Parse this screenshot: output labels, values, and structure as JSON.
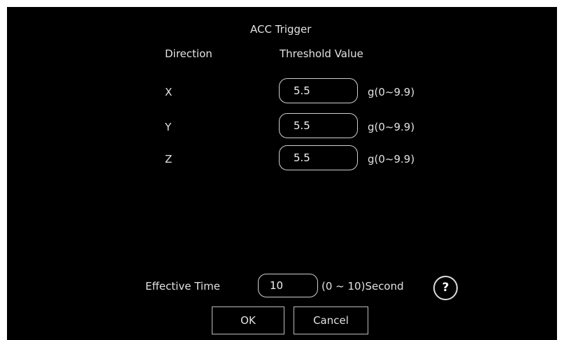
{
  "dialog": {
    "title": "ACC Trigger",
    "headers": {
      "direction": "Direction",
      "threshold": "Threshold Value"
    },
    "rows": [
      {
        "axis": "X",
        "value": "5.5",
        "unit": "g(0~9.9)"
      },
      {
        "axis": "Y",
        "value": "5.5",
        "unit": "g(0~9.9)"
      },
      {
        "axis": "Z",
        "value": "5.5",
        "unit": "g(0~9.9)"
      }
    ],
    "effective_time": {
      "label": "Effective Time",
      "value": "10",
      "range": "(0 ~ 10)Second"
    },
    "help_label": "?",
    "buttons": {
      "ok": "OK",
      "cancel": "Cancel"
    }
  },
  "colors": {
    "background": "#000000",
    "text": "#e2e2e2",
    "border": "#cfcfcf"
  }
}
